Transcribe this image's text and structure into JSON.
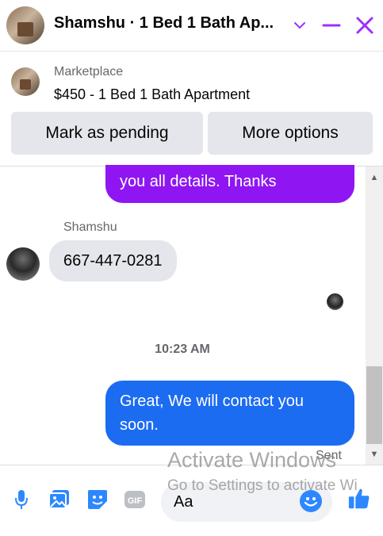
{
  "header": {
    "title": "Shamshu · 1 Bed 1 Bath Ap...",
    "icons": [
      "chevron-down-icon",
      "minimize-icon",
      "close-icon"
    ]
  },
  "listing": {
    "source_label": "Marketplace",
    "title": "$450 - 1 Bed 1 Bath Apartment"
  },
  "actions": {
    "mark_pending": "Mark as pending",
    "more_options": "More options"
  },
  "messages": [
    {
      "from": "me",
      "text": "you all details. Thanks"
    },
    {
      "from": "Shamshu",
      "sender_name": "Shamshu",
      "text": "667-447-0281"
    },
    {
      "timestamp": "10:23 AM"
    },
    {
      "from": "me",
      "text": "Great, We will contact you soon.",
      "status": "Sent"
    }
  ],
  "composer": {
    "placeholder": "Aa",
    "tools": [
      "microphone-icon",
      "photo-icon",
      "sticker-icon",
      "gif-icon",
      "emoji-icon",
      "thumbs-up-icon"
    ],
    "gif_label": "GIF"
  },
  "watermark": {
    "line1": "Activate Windows",
    "line2": "Go to Settings to activate Wi"
  },
  "colors": {
    "accent": "#9b30ff",
    "outgoing_prev": "#8f16f2",
    "outgoing": "#1c6cf2",
    "incoming": "#e4e6eb",
    "icon_blue": "#2d88ff"
  }
}
